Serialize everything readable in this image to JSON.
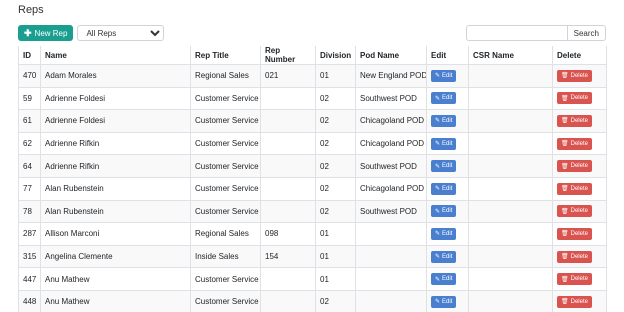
{
  "page": {
    "title": "Reps"
  },
  "toolbar": {
    "new_label": "New Rep",
    "select_value": "All Reps",
    "search_placeholder": "",
    "search_label": "Search"
  },
  "colors": {
    "new_button": "#1a9e8f",
    "edit_button": "#4a7fd0",
    "delete_button": "#d9534f"
  },
  "icons": {
    "new": "plus-icon",
    "edit": "pencil-icon",
    "delete": "trash-icon"
  },
  "table": {
    "headers": [
      "ID",
      "Name",
      "Rep Title",
      "Rep Number",
      "Division",
      "Pod Name",
      "Edit",
      "CSR Name",
      "Delete"
    ],
    "edit_label": "Edit",
    "delete_label": "Delete",
    "rows": [
      {
        "id": "470",
        "name": "Adam Morales",
        "title": "Regional Sales",
        "number": "021",
        "division": "01",
        "pod": "New England POD",
        "csr": ""
      },
      {
        "id": "59",
        "name": "Adrienne Foldesi",
        "title": "Customer Service",
        "number": "",
        "division": "02",
        "pod": "Southwest POD",
        "csr": ""
      },
      {
        "id": "61",
        "name": "Adrienne Foldesi",
        "title": "Customer Service",
        "number": "",
        "division": "02",
        "pod": "Chicagoland POD",
        "csr": ""
      },
      {
        "id": "62",
        "name": "Adrienne Rifkin",
        "title": "Customer Service",
        "number": "",
        "division": "02",
        "pod": "Chicagoland POD",
        "csr": ""
      },
      {
        "id": "64",
        "name": "Adrienne Rifkin",
        "title": "Customer Service",
        "number": "",
        "division": "02",
        "pod": "Southwest POD",
        "csr": ""
      },
      {
        "id": "77",
        "name": "Alan Rubenstein",
        "title": "Customer Service",
        "number": "",
        "division": "02",
        "pod": "Chicagoland POD",
        "csr": ""
      },
      {
        "id": "78",
        "name": "Alan Rubenstein",
        "title": "Customer Service",
        "number": "",
        "division": "02",
        "pod": "Southwest POD",
        "csr": ""
      },
      {
        "id": "287",
        "name": "Allison Marconi",
        "title": "Regional Sales",
        "number": "098",
        "division": "01",
        "pod": "",
        "csr": ""
      },
      {
        "id": "315",
        "name": "Angelina Clemente",
        "title": "Inside Sales",
        "number": "154",
        "division": "01",
        "pod": "",
        "csr": ""
      },
      {
        "id": "447",
        "name": "Anu Mathew",
        "title": "Customer Service",
        "number": "",
        "division": "01",
        "pod": "",
        "csr": ""
      },
      {
        "id": "448",
        "name": "Anu Mathew",
        "title": "Customer Service",
        "number": "",
        "division": "02",
        "pod": "",
        "csr": ""
      }
    ]
  }
}
